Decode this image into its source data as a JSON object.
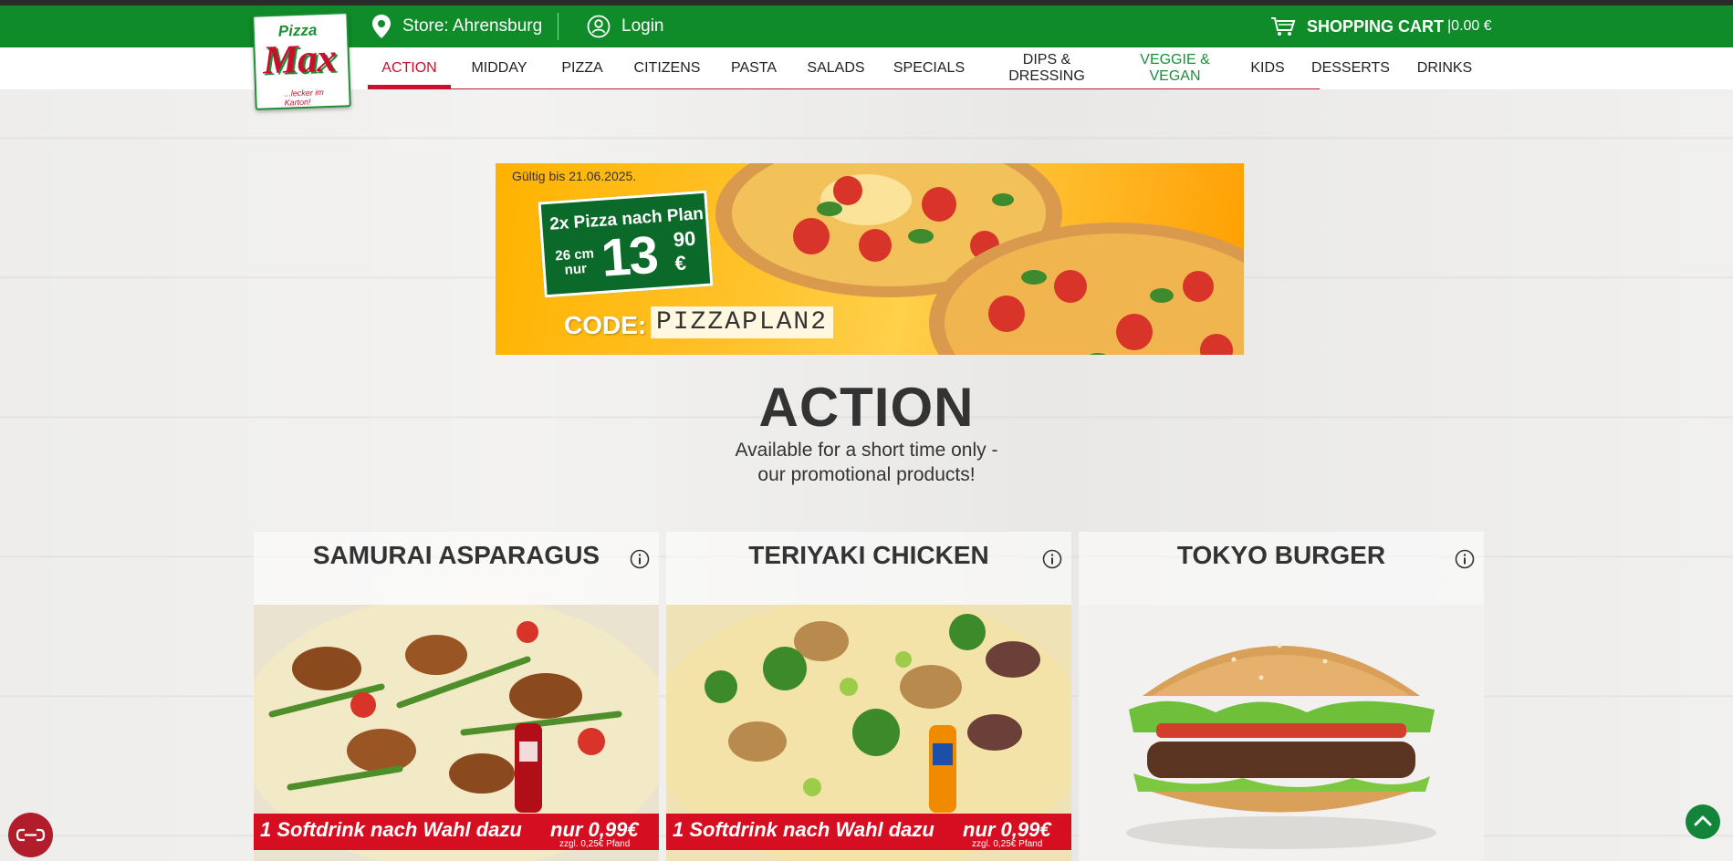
{
  "header": {
    "store_label": "Store: Ahrensburg",
    "login_label": "Login",
    "cart_label": "SHOPPING CART",
    "cart_amount": "|0.00 €"
  },
  "logo": {
    "line1": "Pizza",
    "line2": "Max",
    "tagline": "...lecker im Karton!"
  },
  "nav": {
    "items": [
      {
        "label": "ACTION"
      },
      {
        "label": "MIDDAY"
      },
      {
        "label": "PIZZA"
      },
      {
        "label": "CITIZENS"
      },
      {
        "label": "PASTA"
      },
      {
        "label": "SALADS"
      },
      {
        "label": "SPECIALS"
      },
      {
        "label": "DIPS & DRESSING"
      },
      {
        "label": "VEGGIE & VEGAN"
      },
      {
        "label": "KIDS"
      },
      {
        "label": "DESSERTS"
      },
      {
        "label": "DRINKS"
      }
    ],
    "active": "ACTION"
  },
  "banner": {
    "valid_until": "Gültig bis 21.06.2025.",
    "offer_line": "2x Pizza nach Plan",
    "size": "26 cm nur",
    "price_main": "13",
    "price_cents": "90 €",
    "code_label": "CODE:",
    "code_value": "PIZZAPLAN2"
  },
  "section": {
    "title": "ACTION",
    "subtitle_line1": "Available for a short time only -",
    "subtitle_line2": "our promotional products!"
  },
  "products": [
    {
      "name": "SAMURAI ASPARAGUS",
      "promo": "1 Softdrink nach Wahl dazu",
      "promo_price": "nur 0,99€",
      "promo_note": "zzgl. 0,25€ Pfand"
    },
    {
      "name": "TERIYAKI CHICKEN",
      "promo": "1 Softdrink nach Wahl dazu",
      "promo_price": "nur 0,99€",
      "promo_note": "zzgl. 0,25€ Pfand"
    },
    {
      "name": "TOKYO BURGER"
    }
  ],
  "colors": {
    "brand_green": "#0f8b2a",
    "brand_red": "#c8102e",
    "veggie_green": "#1a8f3a"
  }
}
